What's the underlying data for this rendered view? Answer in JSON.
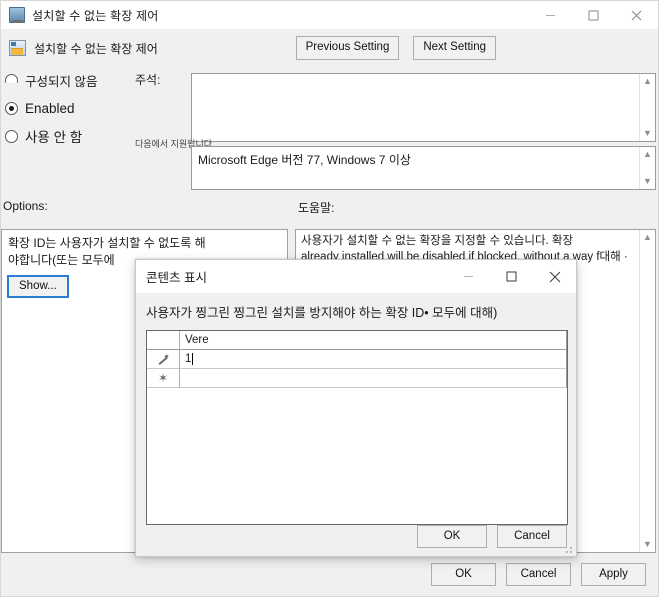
{
  "main_window": {
    "title": "설치할 수 없는 확장 제어",
    "icon": "monitor-policy-icon",
    "window_controls": {
      "minimize": "–",
      "maximize": "□",
      "close": "✕"
    },
    "header": {
      "icon": "policy-setting-icon",
      "subtitle": "설치할 수 없는 확장 제어",
      "previous_setting": "Previous Setting",
      "next_setting": "Next Setting"
    },
    "state": {
      "options": [
        {
          "label": "구성되지 않음",
          "selected": false
        },
        {
          "label": "Enabled",
          "selected": true
        },
        {
          "label": "사용 안 함",
          "selected": false
        }
      ]
    },
    "comment": {
      "label": "주석:",
      "value": ""
    },
    "supported": {
      "label": "다음에서 지원됩니다.",
      "value": "Microsoft Edge 버전 77, Windows 7 이상"
    },
    "options_section": {
      "label": "Options:",
      "description": "확장 ID는 사용자가 설치할 수 없도록 해\n야합니다(또는 모두에",
      "show_button": "Show..."
    },
    "help_section": {
      "label": "도움말:",
      "text": "사용자가 설치할 수 없는 확장을 지정할 수 있습니다. 확장\nalready installed will be disabled if blocked, without a way f대해 ·\n모든\n\ness 사용자).\n\nlicrosoft"
    },
    "footer": {
      "ok": "OK",
      "cancel": "Cancel",
      "apply": "Apply"
    }
  },
  "modal": {
    "title": "콘텐츠 표시",
    "window_controls": {
      "minimize": "–",
      "maximize": "□",
      "close": "✕"
    },
    "label": "사용자가 찡그린 찡그린 설치를 방지해야 하는 확장 ID• 모두에 대해)",
    "grid": {
      "columns": [
        "",
        "Vere"
      ],
      "rows": [
        {
          "marker": "edit-pencil-icon",
          "value": "1",
          "editing": true
        },
        {
          "marker": "new-row-asterisk-icon",
          "value": "",
          "editing": false
        }
      ]
    },
    "footer": {
      "ok": "OK",
      "cancel": "Cancel"
    }
  }
}
